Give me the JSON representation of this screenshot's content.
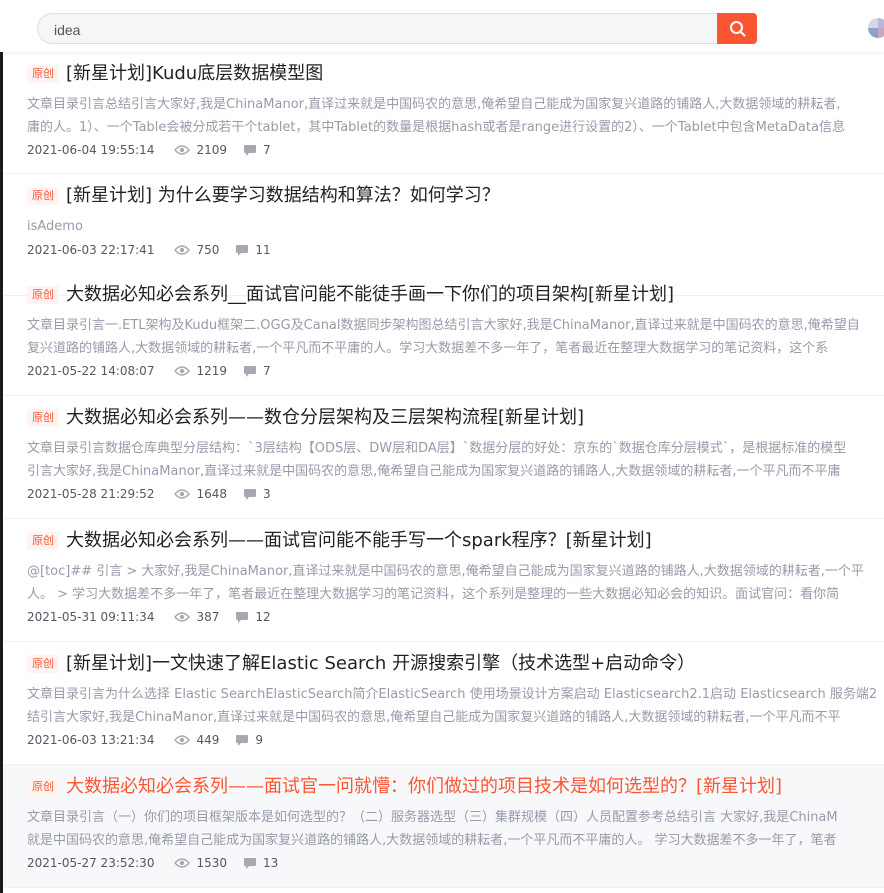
{
  "search": {
    "value": "idea"
  },
  "articles": [
    {
      "tag": "原创",
      "title": "[新星计划]Kudu底层数据模型图",
      "desc1": "文章目录引言总结引言大家好,我是ChinaManor,直译过来就是中国码农的意思,俺希望自己能成为国家复兴道路的铺路人,大数据领域的耕耘者,",
      "desc2": "庸的人。1）、一个Table会被分成若干个tablet，其中Tablet的数量是根据hash或者是range进行设置的2）、一个Tablet中包含MetaData信息",
      "date": "2021-06-04 19:55:14",
      "views": "2109",
      "comments": "7"
    },
    {
      "tag": "原创",
      "title": "[新星计划] 为什么要学习数据结构和算法？如何学习？",
      "desc1": "isAdemo",
      "desc2": "",
      "date": "2021-06-03 22:17:41",
      "views": "750",
      "comments": "11"
    },
    {
      "tag": "原创",
      "title": "大数据必知必会系列__面试官问能不能徒手画一下你们的项目架构[新星计划]",
      "desc1": "文章目录引言一.ETL架构及Kudu框架二.OGG及Canal数据同步架构图总结引言大家好,我是ChinaManor,直译过来就是中国码农的意思,俺希望自",
      "desc2": "复兴道路的铺路人,大数据领域的耕耘者,一个平凡而不平庸的人。学习大数据差不多一年了，笔者最近在整理大数据学习的笔记资料，这个系",
      "date": "2021-05-22 14:08:07",
      "views": "1219",
      "comments": "7"
    },
    {
      "tag": "原创",
      "title": "大数据必知必会系列——数仓分层架构及三层架构流程[新星计划]",
      "desc1": "文章目录引言数据仓库典型分层结构：`3层结构【ODS层、DW层和DA层】`数据分层的好处：京东的`数据仓库分层模式`，是根据标准的模型",
      "desc2": "引言大家好,我是ChinaManor,直译过来就是中国码农的意思,俺希望自己能成为国家复兴道路的铺路人,大数据领域的耕耘者,一个平凡而不平庸",
      "date": "2021-05-28 21:29:52",
      "views": "1648",
      "comments": "3"
    },
    {
      "tag": "原创",
      "title": "大数据必知必会系列——面试官问能不能手写一个spark程序？[新星计划]",
      "desc1": "@[toc]## 引言 > 大家好,我是ChinaManor,直译过来就是中国码农的意思,俺希望自己能成为国家复兴道路的铺路人,大数据领域的耕耘者,一个平",
      "desc2": "人。 > 学习大数据差不多一年了，笔者最近在整理大数据学习的笔记资料，这个系列是整理的一些大数据必知必会的知识。面试官问：看你简",
      "date": "2021-05-31 09:11:34",
      "views": "387",
      "comments": "12"
    },
    {
      "tag": "原创",
      "title": "[新星计划]一文快速了解Elastic Search 开源搜索引擎（技术选型+启动命令）",
      "desc1": "文章目录引言为什么选择 Elastic SearchElasticSearch简介ElasticSearch 使用场景设计方案启动 Elasticsearch2.1启动 Elasticsearch 服务端2",
      "desc2": "结引言大家好,我是ChinaManor,直译过来就是中国码农的意思,俺希望自己能成为国家复兴道路的铺路人,大数据领域的耕耘者,一个平凡而不平",
      "date": "2021-06-03 13:21:34",
      "views": "449",
      "comments": "9"
    },
    {
      "tag": "原创",
      "title": "大数据必知必会系列——面试官一问就懵：你们做过的项目技术是如何选型的？[新星计划]",
      "desc1": "文章目录引言（一）你们的项目框架版本是如何选型的？（二）服务器选型（三）集群规模（四）人员配置参考总结引言 大家好,我是ChinaM",
      "desc2": "就是中国码农的意思,俺希望自己能成为国家复兴道路的铺路人,大数据领域的耕耘者,一个平凡而不平庸的人。 学习大数据差不多一年了，笔者",
      "date": "2021-05-27 23:52:30",
      "views": "1530",
      "comments": "13"
    }
  ]
}
